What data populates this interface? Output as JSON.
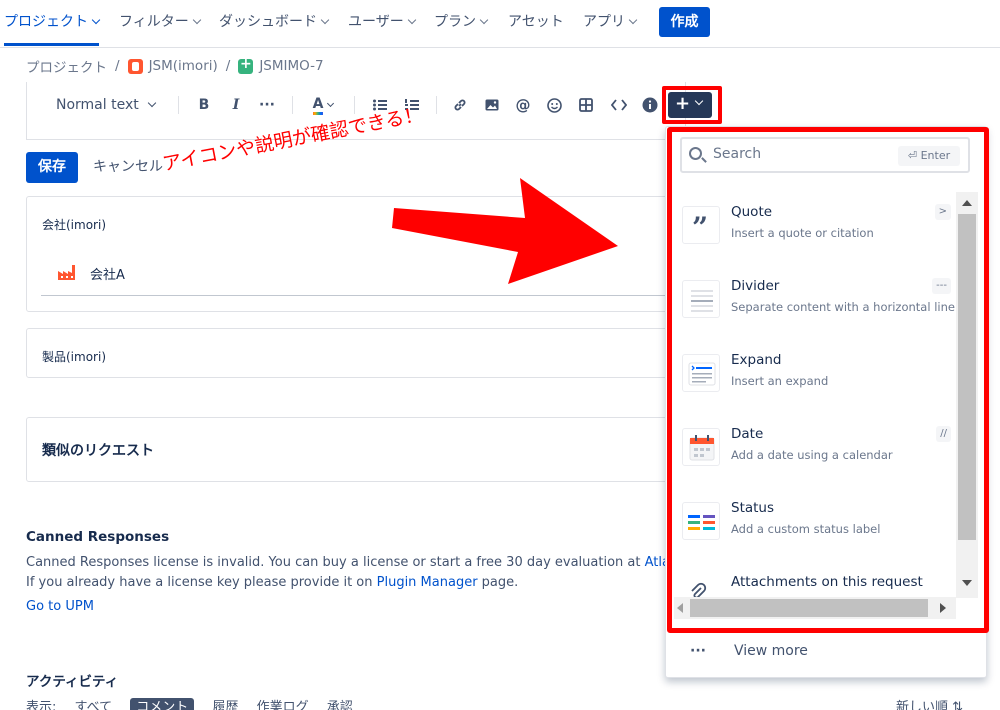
{
  "nav": {
    "items": [
      {
        "label": "プロジェクト"
      },
      {
        "label": "フィルター"
      },
      {
        "label": "ダッシュボード"
      },
      {
        "label": "ユーザー"
      },
      {
        "label": "プラン"
      },
      {
        "label": "アセット"
      },
      {
        "label": "アプリ"
      }
    ],
    "create_label": "作成"
  },
  "breadcrumb": {
    "root": "プロジェクト",
    "project": "JSM(imori)",
    "issue": "JSMIMO-7"
  },
  "toolbar": {
    "text_style": "Normal text",
    "bold": "B",
    "italic": "I",
    "more": "···",
    "color": "A",
    "plus": "+"
  },
  "form": {
    "save_label": "保存",
    "cancel_label": "キャンセル",
    "company_label": "会社(imori)",
    "company_value": "会社A",
    "product_label": "製品(imori)",
    "similar_title": "類似のリクエスト"
  },
  "annotation": {
    "text": "アイコンや説明が確認できる！"
  },
  "canned": {
    "title": "Canned Responses",
    "line1_prefix": "Canned Responses license is invalid. You can buy a license or start a free 30 day evaluation at ",
    "line1_link": "Atlassian M",
    "line2_prefix": "If you already have a license key please provide it on ",
    "line2_link": "Plugin Manager",
    "line2_suffix": " page.",
    "upm_link": "Go to UPM"
  },
  "activity": {
    "title": "アクティビティ",
    "show_label": "表示:",
    "filters": [
      "すべて",
      "コメント",
      "履歴",
      "作業ログ",
      "承認"
    ],
    "sort_label": "新しい順 ⇅"
  },
  "insert_menu": {
    "search_placeholder": "Search",
    "enter_hint": "⏎ Enter",
    "items": [
      {
        "title": "Quote",
        "description": "Insert a quote or citation",
        "shortcut": ">",
        "icon": "quote-icon"
      },
      {
        "title": "Divider",
        "description": "Separate content with a horizontal line",
        "shortcut": "---",
        "icon": "divider-icon"
      },
      {
        "title": "Expand",
        "description": "Insert an expand",
        "shortcut": "",
        "icon": "expand-icon"
      },
      {
        "title": "Date",
        "description": "Add a date using a calendar",
        "shortcut": "//",
        "icon": "calendar-icon"
      },
      {
        "title": "Status",
        "description": "Add a custom status label",
        "shortcut": "",
        "icon": "status-icon"
      },
      {
        "title": "Attachments on this request",
        "description": "",
        "shortcut": "",
        "icon": "paperclip-icon"
      }
    ],
    "view_more": "View more"
  },
  "colors": {
    "brand": "#0052cc",
    "annotation": "#ff0000",
    "toolbar_active": "#253858"
  }
}
